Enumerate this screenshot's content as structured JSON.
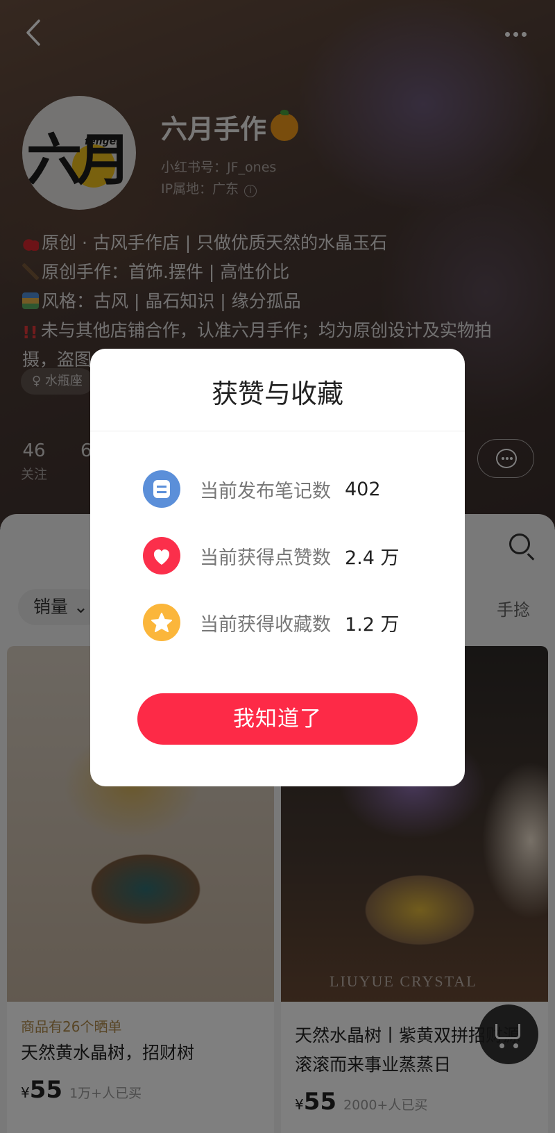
{
  "header": {
    "back_icon": "chevron-left-icon",
    "more_icon": "more-dots-icon"
  },
  "profile": {
    "avatar_text": "六月",
    "avatar_sub": "fenger",
    "nickname": "六月手作",
    "red_id": "小红书号：JF_ones",
    "ip_location": "IP属地：广东",
    "bio": [
      "原创 · 古风手作店 | 只做优质天然的水晶玉石",
      "原创手作：首饰.摆件 | 高性价比",
      "风格：古风 | 晶石知识 | 缘分孤品",
      "未与其他店铺合作，认准六月手作；均为原创设计及实物拍",
      "摄，盗图"
    ],
    "tag": "♀ 水瓶座",
    "stats": [
      {
        "value": "46",
        "label": "关注"
      },
      {
        "value": "6",
        "label": ""
      }
    ]
  },
  "shop": {
    "sort_label": "销量",
    "right_filter": "手捻",
    "cards": [
      {
        "promo": "商品有26个晒单",
        "title": "天然黄水晶树，招财树",
        "currency": "¥",
        "price": "55",
        "sold": "1万+人已买"
      },
      {
        "watermark": "LIUYUE CRYSTAL",
        "title": "天然水晶树丨紫黄双拼招财源滚滚而来事业蒸蒸日",
        "currency": "¥",
        "price": "55",
        "sold": "2000+人已买"
      }
    ]
  },
  "modal": {
    "title": "获赞与收藏",
    "rows": [
      {
        "label": "当前发布笔记数",
        "value": "402",
        "icon": "note-icon",
        "color": "#5b8fd9"
      },
      {
        "label": "当前获得点赞数",
        "value": "2.4 万",
        "icon": "heart-icon",
        "color": "#fb2f4b"
      },
      {
        "label": "当前获得收藏数",
        "value": "1.2 万",
        "icon": "star-icon",
        "color": "#fbb63b"
      }
    ],
    "confirm_label": "我知道了"
  }
}
